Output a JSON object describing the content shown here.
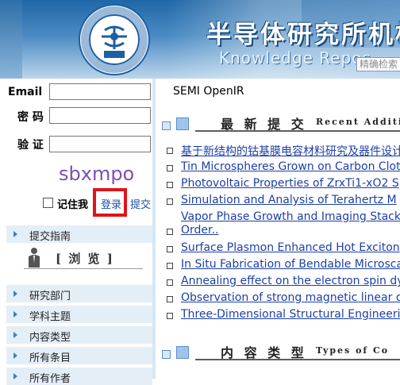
{
  "header": {
    "title_cn": "半导体研究所机构",
    "title_en": "Knowledge Repos",
    "search_placeholder": "精确检索",
    "seal": {
      "ring_text": "Institute of Semiconductors CAS",
      "year": "1960",
      "bottom_text": "中国科学院半导体研究所"
    }
  },
  "login": {
    "email_label": "Email",
    "password_label": "密 码",
    "verify_label": "验 证",
    "captcha_text": "sbxmpo",
    "remember_label": "记住我",
    "login_label": "登录",
    "submit_label": "提交"
  },
  "left_nav": {
    "submit_guide": "提交指南",
    "browse_title": "[ 浏 览 ]",
    "items": [
      "研究部门",
      "学科主题",
      "内容类型",
      "所有条目",
      "所有作者"
    ]
  },
  "main": {
    "heading": "SEMI OpenIR",
    "recent": {
      "title_cn": "最 新 提 交",
      "title_en": "Recent Additi"
    },
    "items": [
      "基于新结构的钴基膜电容材料研究及器件设计",
      "Tin Microspheres Grown on Carbon Clot",
      "Photovoltaic Properties of ZrxTi1-xO2 S",
      "Simulation and Analysis of Terahertz M",
      "Vapor Phase Growth and Imaging Stack",
      "Surface Plasmon Enhanced Hot Exciton",
      "In Situ Fabrication of Bendable Microsca",
      "Annealing effect on the electron spin dy",
      "Observation of strong magnetic linear d",
      "Three-Dimensional Structural Engineeri"
    ],
    "item_4_continuation": "Order..",
    "types": {
      "title_cn": "内 容 类 型",
      "title_en": "Types of Co"
    }
  },
  "colors": {
    "link": "#1c3fa8",
    "login_highlight": "#e0141b",
    "nav_bg": "#e4eef7",
    "header_blue": "#1f67a7"
  }
}
